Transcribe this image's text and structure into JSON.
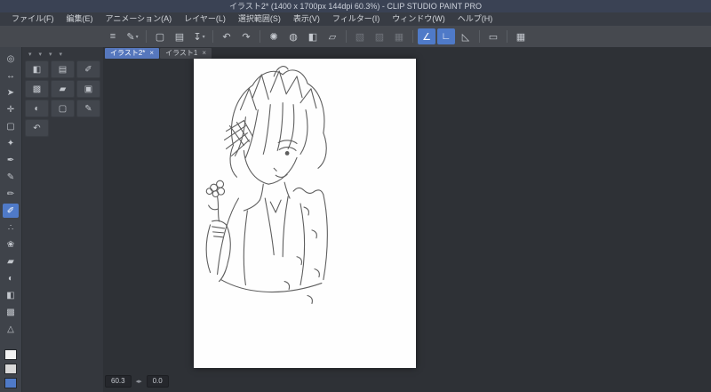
{
  "colors": {
    "accent": "#4f7ac8",
    "titlebar": "#3a4254",
    "canvas_bg": "#fefefe",
    "ui_dark": "#34373d"
  },
  "window": {
    "title": "イラスト2* (1400 x 1700px 144dpi 60.3%) - CLIP STUDIO PAINT PRO"
  },
  "menubar": {
    "items": [
      {
        "label": "ファイル(F)"
      },
      {
        "label": "編集(E)"
      },
      {
        "label": "アニメーション(A)"
      },
      {
        "label": "レイヤー(L)"
      },
      {
        "label": "選択範囲(S)"
      },
      {
        "label": "表示(V)"
      },
      {
        "label": "フィルター(I)"
      },
      {
        "label": "ウィンドウ(W)"
      },
      {
        "label": "ヘルプ(H)"
      }
    ]
  },
  "toolbar": {
    "items": [
      {
        "name": "main-menu",
        "glyph": "≡",
        "state": "normal"
      },
      {
        "name": "current-tool",
        "glyph": "✎",
        "state": "normal",
        "caret": "▾"
      },
      {
        "name": "new-document",
        "glyph": "▢",
        "state": "normal"
      },
      {
        "name": "open-file",
        "glyph": "▤",
        "state": "normal"
      },
      {
        "name": "save-file",
        "glyph": "↧",
        "state": "normal",
        "caret": "▾"
      },
      {
        "name": "undo",
        "glyph": "↶",
        "state": "normal"
      },
      {
        "name": "redo",
        "glyph": "↷",
        "state": "normal"
      },
      {
        "name": "clear",
        "glyph": "✺",
        "state": "normal"
      },
      {
        "name": "clear-outside-selection",
        "glyph": "◍",
        "state": "normal"
      },
      {
        "name": "fill",
        "glyph": "◧",
        "state": "normal"
      },
      {
        "name": "crop",
        "glyph": "▱",
        "state": "normal"
      },
      {
        "name": "deselect",
        "glyph": "▧",
        "state": "disabled"
      },
      {
        "name": "invert-selection",
        "glyph": "▨",
        "state": "disabled"
      },
      {
        "name": "selection-border",
        "glyph": "▦",
        "state": "disabled"
      },
      {
        "name": "snap-to-ruler",
        "glyph": "∠",
        "state": "active"
      },
      {
        "name": "snap-to-special-ruler",
        "glyph": "∟",
        "state": "active"
      },
      {
        "name": "snap-to-grid",
        "glyph": "◺",
        "state": "normal"
      },
      {
        "name": "ruler-settings",
        "glyph": "▭",
        "state": "normal"
      },
      {
        "name": "grid",
        "glyph": "▦",
        "state": "normal"
      }
    ]
  },
  "tool_strip": {
    "selected_index": 9,
    "tools": [
      {
        "name": "zoom",
        "glyph": "◎"
      },
      {
        "name": "move",
        "glyph": "↔"
      },
      {
        "name": "operation",
        "glyph": "➤"
      },
      {
        "name": "layer-move",
        "glyph": "✛"
      },
      {
        "name": "selection",
        "glyph": "▢"
      },
      {
        "name": "auto-select",
        "glyph": "✦"
      },
      {
        "name": "eyedropper",
        "glyph": "✒"
      },
      {
        "name": "pen",
        "glyph": "✎"
      },
      {
        "name": "pencil",
        "glyph": "✏"
      },
      {
        "name": "brush",
        "glyph": "✐"
      },
      {
        "name": "airbrush",
        "glyph": "∴"
      },
      {
        "name": "decoration",
        "glyph": "❀"
      },
      {
        "name": "eraser",
        "glyph": "▰"
      },
      {
        "name": "blend",
        "glyph": "◐"
      },
      {
        "name": "fill-bucket",
        "glyph": "◧"
      },
      {
        "name": "gradient",
        "glyph": "▩"
      },
      {
        "name": "figure",
        "glyph": "△"
      }
    ],
    "swatches": [
      {
        "name": "main-color",
        "color": "#f2f2f2"
      },
      {
        "name": "sub-color",
        "color": "#d8d8d8"
      },
      {
        "name": "transparent-color",
        "color": "#4f7ac8"
      }
    ]
  },
  "subtool_panel": {
    "headers": [
      {
        "name": "palette-tab-1",
        "glyph": "▾"
      },
      {
        "name": "palette-tab-2",
        "glyph": "▾"
      },
      {
        "name": "palette-tab-3",
        "glyph": "▾"
      },
      {
        "name": "palette-tab-4",
        "glyph": "▾"
      }
    ],
    "cells": [
      {
        "name": "subtool-fill",
        "glyph": "◧"
      },
      {
        "name": "subtool-layers",
        "glyph": "▤"
      },
      {
        "name": "subtool-brush",
        "glyph": "✐"
      },
      {
        "name": "subtool-gradient",
        "glyph": "▩"
      },
      {
        "name": "subtool-eraser",
        "glyph": "▰"
      },
      {
        "name": "subtool-stamp",
        "glyph": "▣"
      },
      {
        "name": "subtool-mixer",
        "glyph": "◐"
      },
      {
        "name": "subtool-select",
        "glyph": "▢"
      },
      {
        "name": "subtool-pen",
        "glyph": "✎"
      },
      {
        "name": "subtool-history",
        "glyph": "↶"
      }
    ]
  },
  "canvas": {
    "tabs": [
      {
        "label": "イラスト2*",
        "active": true
      },
      {
        "label": "イラスト1",
        "active": false
      }
    ],
    "tab_close_glyph": "×"
  },
  "statusbar": {
    "zoom": "60.3",
    "angle": "0.0",
    "zoom_tri": "◂▸"
  }
}
